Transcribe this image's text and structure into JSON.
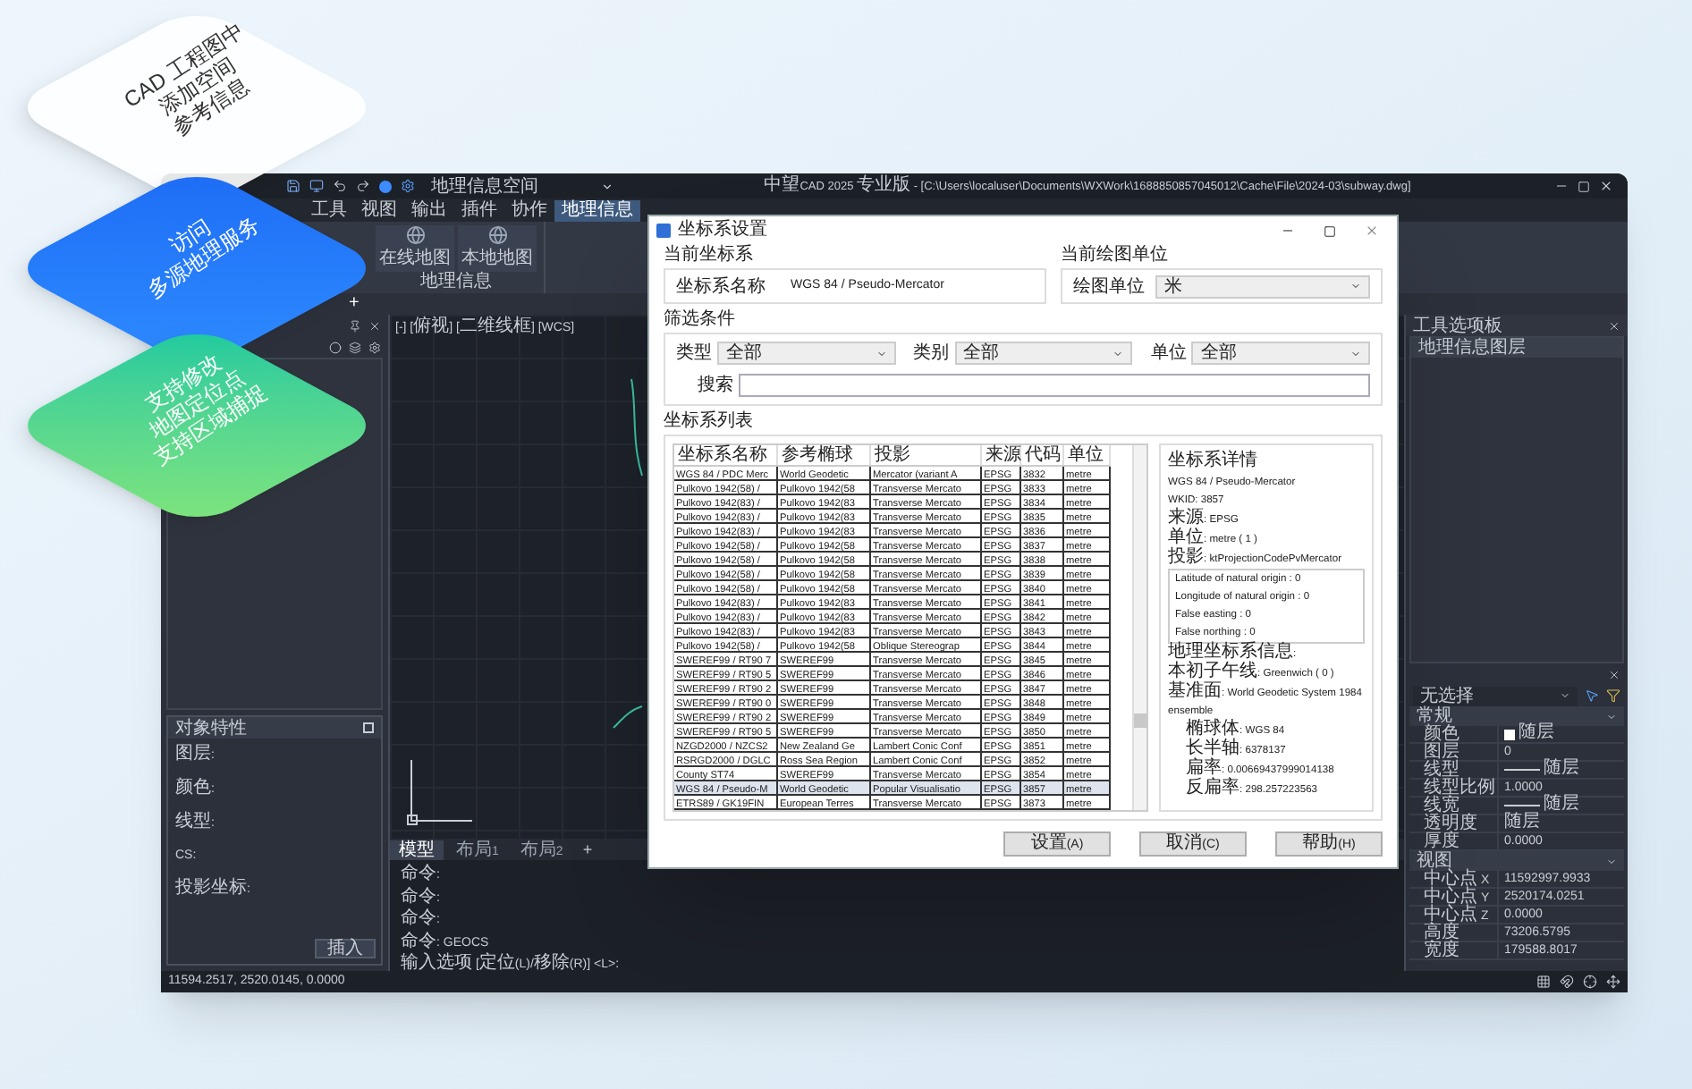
{
  "cards": [
    {
      "kind": "white",
      "lines": [
        "CAD 工程图中",
        "添加空间",
        "参考信息"
      ]
    },
    {
      "kind": "blue",
      "lines": [
        "访问",
        "多源地理服务"
      ]
    },
    {
      "kind": "green",
      "lines": [
        "支持修改",
        "地图定位点",
        "支持区域捕捉"
      ]
    }
  ],
  "app": {
    "workspace": "地理信息空间",
    "title": "中望CAD 2025 专业版 - [C:\\Users\\localuser\\Documents\\WXWork\\1688850857045012\\Cache\\File\\2024-03\\subway.dwg]",
    "ribbon_tabs": [
      {
        "label": "工具",
        "selected": false
      },
      {
        "label": "视图",
        "selected": false
      },
      {
        "label": "输出",
        "selected": false
      },
      {
        "label": "插件",
        "selected": false
      },
      {
        "label": "协作",
        "selected": false
      },
      {
        "label": "地理信息",
        "selected": true
      }
    ],
    "ribbon_buttons": [
      "在线地图",
      "本地地图"
    ],
    "ribbon_group": "地理信息",
    "doc_tab_add": "+",
    "viewport_label": "[-] [俯视] [二维线框] [WCS]",
    "left_panel": {
      "title": "对象特性",
      "fields": [
        "图层:",
        "颜色:",
        "线型:",
        "CS:",
        "投影坐标:"
      ],
      "button": "插入"
    },
    "layout_tabs": [
      {
        "label": "模型",
        "selected": true
      },
      {
        "label": "布局1",
        "selected": false
      },
      {
        "label": "布局2",
        "selected": false
      }
    ],
    "layout_add": "+",
    "command_lines": [
      "命令:",
      "命令:",
      "命令:",
      "命令:  GEOCS",
      "输入选项 [定位(L)/移除(R)] <L>:"
    ],
    "status_coords": "11594.2517, 2520.0145, 0.0000",
    "right_panel": {
      "title": "工具选项板",
      "item": "地理信息图层",
      "selection": "无选择",
      "groups": [
        {
          "title": "常规",
          "rows": [
            {
              "label": "颜色",
              "value": "随层",
              "kind": "swatch"
            },
            {
              "label": "图层",
              "value": "0",
              "kind": "text"
            },
            {
              "label": "线型",
              "value": "随层",
              "kind": "line"
            },
            {
              "label": "线型比例",
              "value": "1.0000",
              "kind": "text"
            },
            {
              "label": "线宽",
              "value": "随层",
              "kind": "line"
            },
            {
              "label": "透明度",
              "value": "随层",
              "kind": "text"
            },
            {
              "label": "厚度",
              "value": "0.0000",
              "kind": "text"
            }
          ]
        },
        {
          "title": "视图",
          "rows": [
            {
              "label": "中心点 X",
              "value": "11592997.9933",
              "kind": "text"
            },
            {
              "label": "中心点 Y",
              "value": "2520174.0251",
              "kind": "text"
            },
            {
              "label": "中心点 Z",
              "value": "0.0000",
              "kind": "text"
            },
            {
              "label": "高度",
              "value": "73206.5795",
              "kind": "text"
            },
            {
              "label": "宽度",
              "value": "179588.8017",
              "kind": "text"
            }
          ]
        }
      ]
    }
  },
  "dialog": {
    "title": "坐标系设置",
    "current_group": "当前坐标系",
    "current_label": "坐标系名称",
    "current_value": "WGS 84 / Pseudo-Mercator",
    "unit_group": "当前绘图单位",
    "unit_label": "绘图单位",
    "unit_value": "米",
    "filter_group": "筛选条件",
    "filters": [
      {
        "label": "类型",
        "value": "全部"
      },
      {
        "label": "类别",
        "value": "全部"
      },
      {
        "label": "单位",
        "value": "全部"
      }
    ],
    "search_label": "搜索",
    "list_group": "坐标系列表",
    "columns": [
      "坐标系名称",
      "参考椭球",
      "投影",
      "来源",
      "代码",
      "单位"
    ],
    "rows": [
      {
        "cells": [
          "WGS 84 / PDC Merc",
          "World Geodetic",
          "Mercator (variant A",
          "EPSG",
          "3832",
          "metre"
        ],
        "selected": false
      },
      {
        "cells": [
          "Pulkovo 1942(58) /",
          "Pulkovo 1942(58",
          "Transverse Mercato",
          "EPSG",
          "3833",
          "metre"
        ],
        "selected": false
      },
      {
        "cells": [
          "Pulkovo 1942(83) /",
          "Pulkovo 1942(83",
          "Transverse Mercato",
          "EPSG",
          "3834",
          "metre"
        ],
        "selected": false
      },
      {
        "cells": [
          "Pulkovo 1942(83) /",
          "Pulkovo 1942(83",
          "Transverse Mercato",
          "EPSG",
          "3835",
          "metre"
        ],
        "selected": false
      },
      {
        "cells": [
          "Pulkovo 1942(83) /",
          "Pulkovo 1942(83",
          "Transverse Mercato",
          "EPSG",
          "3836",
          "metre"
        ],
        "selected": false
      },
      {
        "cells": [
          "Pulkovo 1942(58) /",
          "Pulkovo 1942(58",
          "Transverse Mercato",
          "EPSG",
          "3837",
          "metre"
        ],
        "selected": false
      },
      {
        "cells": [
          "Pulkovo 1942(58) /",
          "Pulkovo 1942(58",
          "Transverse Mercato",
          "EPSG",
          "3838",
          "metre"
        ],
        "selected": false
      },
      {
        "cells": [
          "Pulkovo 1942(58) /",
          "Pulkovo 1942(58",
          "Transverse Mercato",
          "EPSG",
          "3839",
          "metre"
        ],
        "selected": false
      },
      {
        "cells": [
          "Pulkovo 1942(58) /",
          "Pulkovo 1942(58",
          "Transverse Mercato",
          "EPSG",
          "3840",
          "metre"
        ],
        "selected": false
      },
      {
        "cells": [
          "Pulkovo 1942(83) /",
          "Pulkovo 1942(83",
          "Transverse Mercato",
          "EPSG",
          "3841",
          "metre"
        ],
        "selected": false
      },
      {
        "cells": [
          "Pulkovo 1942(83) /",
          "Pulkovo 1942(83",
          "Transverse Mercato",
          "EPSG",
          "3842",
          "metre"
        ],
        "selected": false
      },
      {
        "cells": [
          "Pulkovo 1942(83) /",
          "Pulkovo 1942(83",
          "Transverse Mercato",
          "EPSG",
          "3843",
          "metre"
        ],
        "selected": false
      },
      {
        "cells": [
          "Pulkovo 1942(58) /",
          "Pulkovo 1942(58",
          "Oblique Stereograp",
          "EPSG",
          "3844",
          "metre"
        ],
        "selected": false
      },
      {
        "cells": [
          "SWEREF99 / RT90 7",
          "SWEREF99",
          "Transverse Mercato",
          "EPSG",
          "3845",
          "metre"
        ],
        "selected": false
      },
      {
        "cells": [
          "SWEREF99 / RT90 5",
          "SWEREF99",
          "Transverse Mercato",
          "EPSG",
          "3846",
          "metre"
        ],
        "selected": false
      },
      {
        "cells": [
          "SWEREF99 / RT90 2",
          "SWEREF99",
          "Transverse Mercato",
          "EPSG",
          "3847",
          "metre"
        ],
        "selected": false
      },
      {
        "cells": [
          "SWEREF99 / RT90 0",
          "SWEREF99",
          "Transverse Mercato",
          "EPSG",
          "3848",
          "metre"
        ],
        "selected": false
      },
      {
        "cells": [
          "SWEREF99 / RT90 2",
          "SWEREF99",
          "Transverse Mercato",
          "EPSG",
          "3849",
          "metre"
        ],
        "selected": false
      },
      {
        "cells": [
          "SWEREF99 / RT90 5",
          "SWEREF99",
          "Transverse Mercato",
          "EPSG",
          "3850",
          "metre"
        ],
        "selected": false
      },
      {
        "cells": [
          "NZGD2000 / NZCS2",
          "New Zealand Ge",
          "Lambert Conic Conf",
          "EPSG",
          "3851",
          "metre"
        ],
        "selected": false
      },
      {
        "cells": [
          "RSRGD2000 / DGLC",
          "Ross Sea Region",
          "Lambert Conic Conf",
          "EPSG",
          "3852",
          "metre"
        ],
        "selected": false
      },
      {
        "cells": [
          "County ST74",
          "SWEREF99",
          "Transverse Mercato",
          "EPSG",
          "3854",
          "metre"
        ],
        "selected": false
      },
      {
        "cells": [
          "WGS 84 / Pseudo-M",
          "World Geodetic",
          "Popular Visualisatio",
          "EPSG",
          "3857",
          "metre"
        ],
        "selected": true
      },
      {
        "cells": [
          "ETRS89 / GK19FIN",
          "European Terres",
          "Transverse Mercato",
          "EPSG",
          "3873",
          "metre"
        ],
        "selected": false
      }
    ],
    "detail_group": "坐标系详情",
    "details": [
      {
        "kind": "plain",
        "text": "WGS 84 / Pseudo-Mercator"
      },
      {
        "kind": "plain",
        "text": "WKID: 3857"
      },
      {
        "kind": "plain",
        "text": "来源: EPSG"
      },
      {
        "kind": "plain",
        "text": "单位: metre ( 1 )"
      },
      {
        "kind": "plain",
        "text": "投影: ktProjectionCodePvMercator"
      },
      {
        "kind": "param",
        "text": "Latitude of natural origin : 0"
      },
      {
        "kind": "param",
        "text": "Longitude of natural origin : 0"
      },
      {
        "kind": "param",
        "text": "False easting : 0"
      },
      {
        "kind": "param",
        "text": "False northing : 0"
      },
      {
        "kind": "plain",
        "text": "地理坐标系信息:"
      },
      {
        "kind": "plain",
        "text": "本初子午线: Greenwich ( 0 )"
      },
      {
        "kind": "plain",
        "text": "基准面: World Geodetic System 1984 ensemble"
      },
      {
        "kind": "indent",
        "text": "椭球体: WGS 84"
      },
      {
        "kind": "indent",
        "text": "长半轴: 6378137"
      },
      {
        "kind": "indent",
        "text": "扁率: 0.00669437999014138"
      },
      {
        "kind": "indent",
        "text": "反扁率: 298.257223563"
      }
    ],
    "buttons": [
      "设置(A)",
      "取消(C)",
      "帮助(H)"
    ]
  }
}
